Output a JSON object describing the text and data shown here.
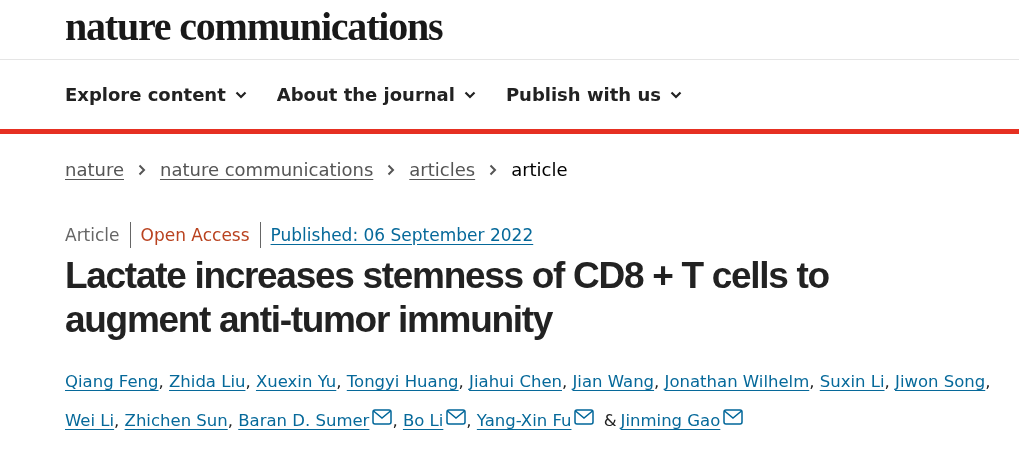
{
  "logo": "nature communications",
  "nav": [
    {
      "label": "Explore content"
    },
    {
      "label": "About the journal"
    },
    {
      "label": "Publish with us"
    }
  ],
  "breadcrumbs": [
    {
      "label": "nature",
      "current": false
    },
    {
      "label": "nature communications",
      "current": false
    },
    {
      "label": "articles",
      "current": false
    },
    {
      "label": "article",
      "current": true
    }
  ],
  "meta": {
    "type": "Article",
    "access": "Open Access",
    "published": "Published: 06 September 2022"
  },
  "title": "Lactate increases stemness of CD8 + T cells to augment anti-tumor immunity",
  "authors": [
    {
      "name": "Qiang Feng",
      "corresponding": false,
      "sep": ","
    },
    {
      "name": "Zhida Liu",
      "corresponding": false,
      "sep": ","
    },
    {
      "name": "Xuexin Yu",
      "corresponding": false,
      "sep": ","
    },
    {
      "name": "Tongyi Huang",
      "corresponding": false,
      "sep": ","
    },
    {
      "name": "Jiahui Chen",
      "corresponding": false,
      "sep": ","
    },
    {
      "name": "Jian Wang",
      "corresponding": false,
      "sep": ","
    },
    {
      "name": "Jonathan Wilhelm",
      "corresponding": false,
      "sep": ","
    },
    {
      "name": "Suxin Li",
      "corresponding": false,
      "sep": ","
    },
    {
      "name": "Jiwon Song",
      "corresponding": false,
      "sep": ","
    },
    {
      "name": "Wei Li",
      "corresponding": false,
      "sep": ","
    },
    {
      "name": "Zhichen Sun",
      "corresponding": false,
      "sep": ","
    },
    {
      "name": "Baran D. Sumer",
      "corresponding": true,
      "sep": ","
    },
    {
      "name": "Bo Li",
      "corresponding": true,
      "sep": ","
    },
    {
      "name": "Yang-Xin Fu",
      "corresponding": true,
      "sep": "&"
    },
    {
      "name": "Jinming Gao",
      "corresponding": true
    }
  ]
}
